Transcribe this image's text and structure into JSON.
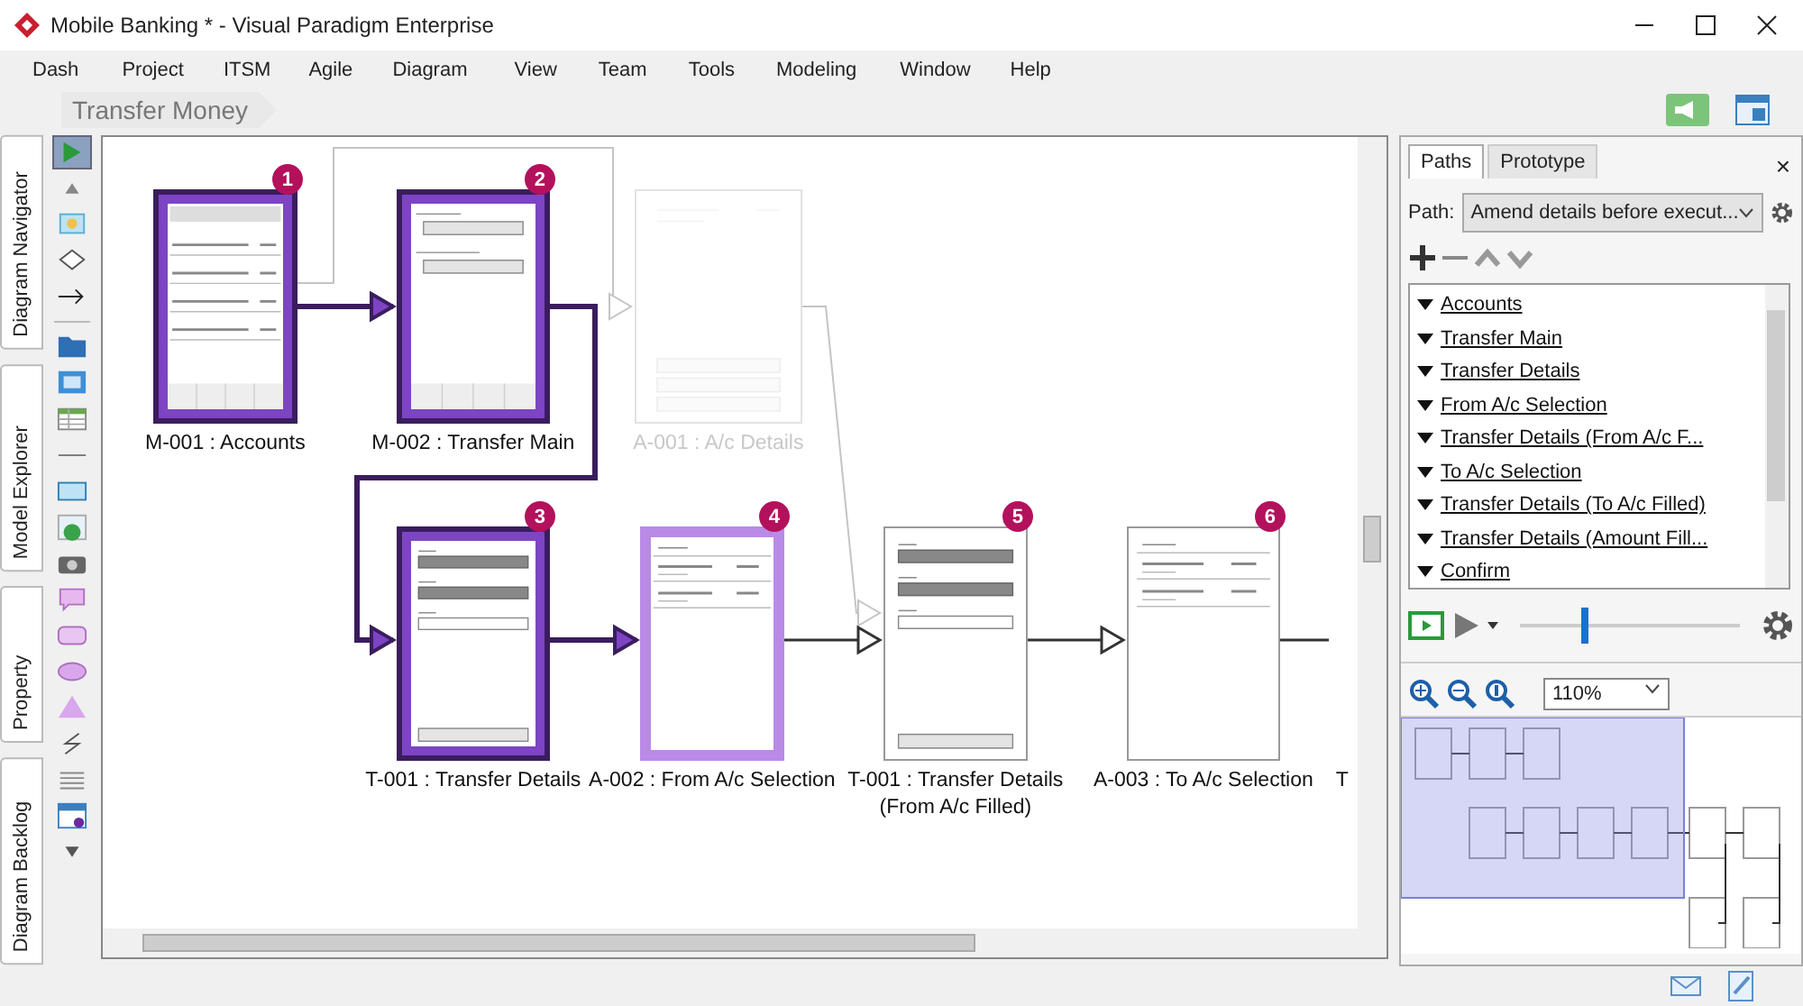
{
  "window": {
    "title": "Mobile Banking * - Visual Paradigm Enterprise"
  },
  "menu": [
    "Dash",
    "Project",
    "ITSM",
    "Agile",
    "Diagram",
    "View",
    "Team",
    "Tools",
    "Modeling",
    "Window",
    "Help"
  ],
  "breadcrumb": "Transfer Money",
  "side_tabs": [
    "Diagram Navigator",
    "Model Explorer",
    "Property",
    "Diagram Backlog"
  ],
  "palette": [
    {
      "kind": "pointer",
      "selected": true
    },
    {
      "kind": "up"
    },
    {
      "kind": "screen",
      "selected": false
    },
    {
      "kind": "diamond",
      "selected": false
    },
    {
      "kind": "arrow",
      "selected": false
    },
    {
      "kind": "separator"
    },
    {
      "kind": "folder",
      "selected": false
    },
    {
      "kind": "screens",
      "selected": false
    },
    {
      "kind": "table",
      "selected": false
    },
    {
      "kind": "line",
      "selected": false
    },
    {
      "kind": "panel",
      "selected": false
    },
    {
      "kind": "image",
      "selected": false
    },
    {
      "kind": "camera",
      "selected": false
    },
    {
      "kind": "callout",
      "selected": false
    },
    {
      "kind": "roundrect",
      "selected": false
    },
    {
      "kind": "ellipse",
      "selected": false
    },
    {
      "kind": "triangle",
      "selected": false
    },
    {
      "kind": "zigzag",
      "selected": false
    },
    {
      "kind": "lines",
      "selected": false
    },
    {
      "kind": "window",
      "selected": false
    },
    {
      "kind": "down"
    }
  ],
  "diagram": {
    "nodes": [
      {
        "kind": "visited",
        "badge": "1",
        "label": "M-001 : Accounts"
      },
      {
        "kind": "visited",
        "badge": "2",
        "label": "M-002 : Transfer Main"
      },
      {
        "kind": "faded",
        "label": "A-001 : A/c Details"
      },
      {
        "kind": "visited",
        "badge": "3",
        "label": "T-001 : Transfer Details"
      },
      {
        "kind": "current",
        "badge": "4",
        "label": "A-002 : From A/c Selection"
      },
      {
        "kind": "plain",
        "badge": "5",
        "label": "T-001 : Transfer Details",
        "sublabel": "(From A/c Filled)"
      },
      {
        "kind": "plain",
        "badge": "6",
        "label": "A-003 : To A/c Selection"
      },
      {
        "kind": "cut",
        "label": "T"
      }
    ],
    "edges": [
      {
        "kind": "visited"
      },
      {
        "kind": "visited"
      },
      {
        "kind": "faded"
      },
      {
        "kind": "faded"
      },
      {
        "kind": "visited"
      },
      {
        "kind": "plain"
      },
      {
        "kind": "plain"
      },
      {
        "kind": "plain"
      }
    ]
  },
  "panel": {
    "tabs": [
      {
        "label": "Paths",
        "selected": true
      },
      {
        "label": "Prototype",
        "selected": false
      }
    ],
    "close": "×",
    "path_label": "Path:",
    "path_value": "Amend details before execut...",
    "steps": [
      "Accounts",
      "Transfer Main",
      "Transfer Details",
      "From A/c Selection",
      "Transfer Details (From A/c F...",
      "To A/c Selection",
      "Transfer Details (To A/c Filled)",
      "Transfer Details (Amount Fill...",
      "Confirm"
    ],
    "player": {
      "level": 0.28
    },
    "zoom": "110%"
  }
}
